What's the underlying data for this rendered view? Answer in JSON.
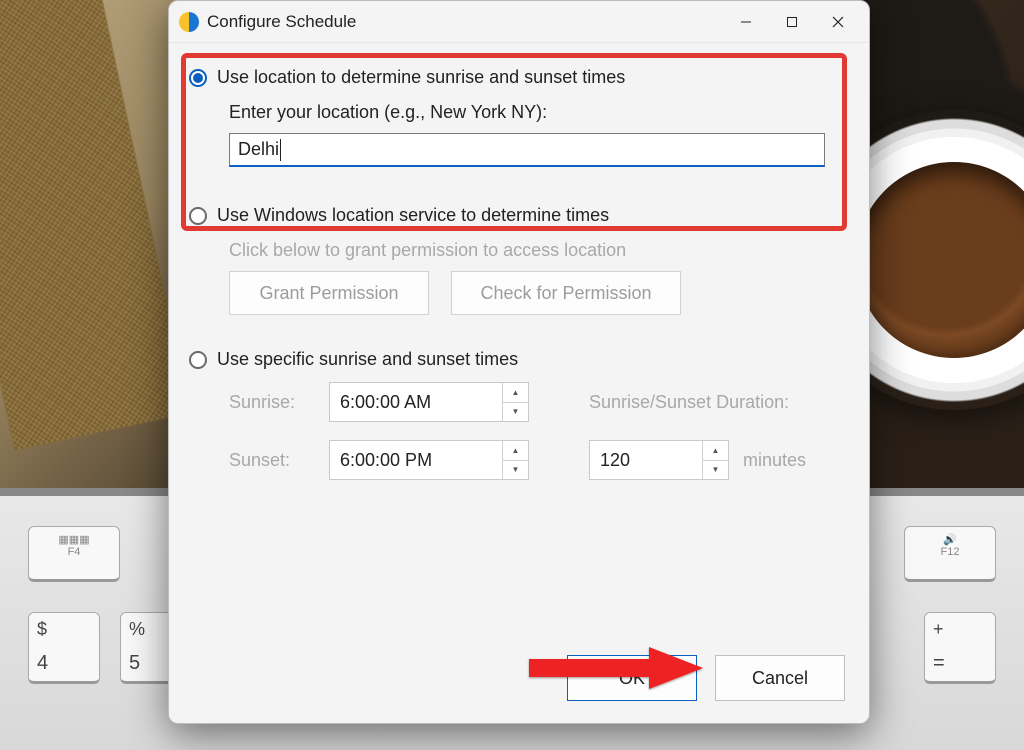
{
  "window": {
    "title": "Configure Schedule"
  },
  "option1": {
    "label": "Use location to determine sunrise and sunset times",
    "prompt": "Enter your location (e.g., New York NY):",
    "value": "Delhi",
    "selected": true
  },
  "option2": {
    "label": "Use Windows location service to determine times",
    "hint": "Click below to grant permission to access location",
    "grant_btn": "Grant Permission",
    "check_btn": "Check for Permission",
    "selected": false
  },
  "option3": {
    "label": "Use specific sunrise and sunset times",
    "sunrise_label": "Sunrise:",
    "sunrise_value": "6:00:00 AM",
    "sunset_label": "Sunset:",
    "sunset_value": "6:00:00 PM",
    "duration_label": "Sunrise/Sunset Duration:",
    "duration_value": "120",
    "duration_unit": "minutes",
    "selected": false
  },
  "footer": {
    "ok": "OK",
    "cancel": "Cancel"
  },
  "keyboard": {
    "f4": "F4",
    "f12": "F12",
    "dollar_top": "$",
    "dollar_bot": "4",
    "percent_top": "%",
    "percent_bot": "5",
    "plus_top": "+",
    "plus_bot": "="
  }
}
